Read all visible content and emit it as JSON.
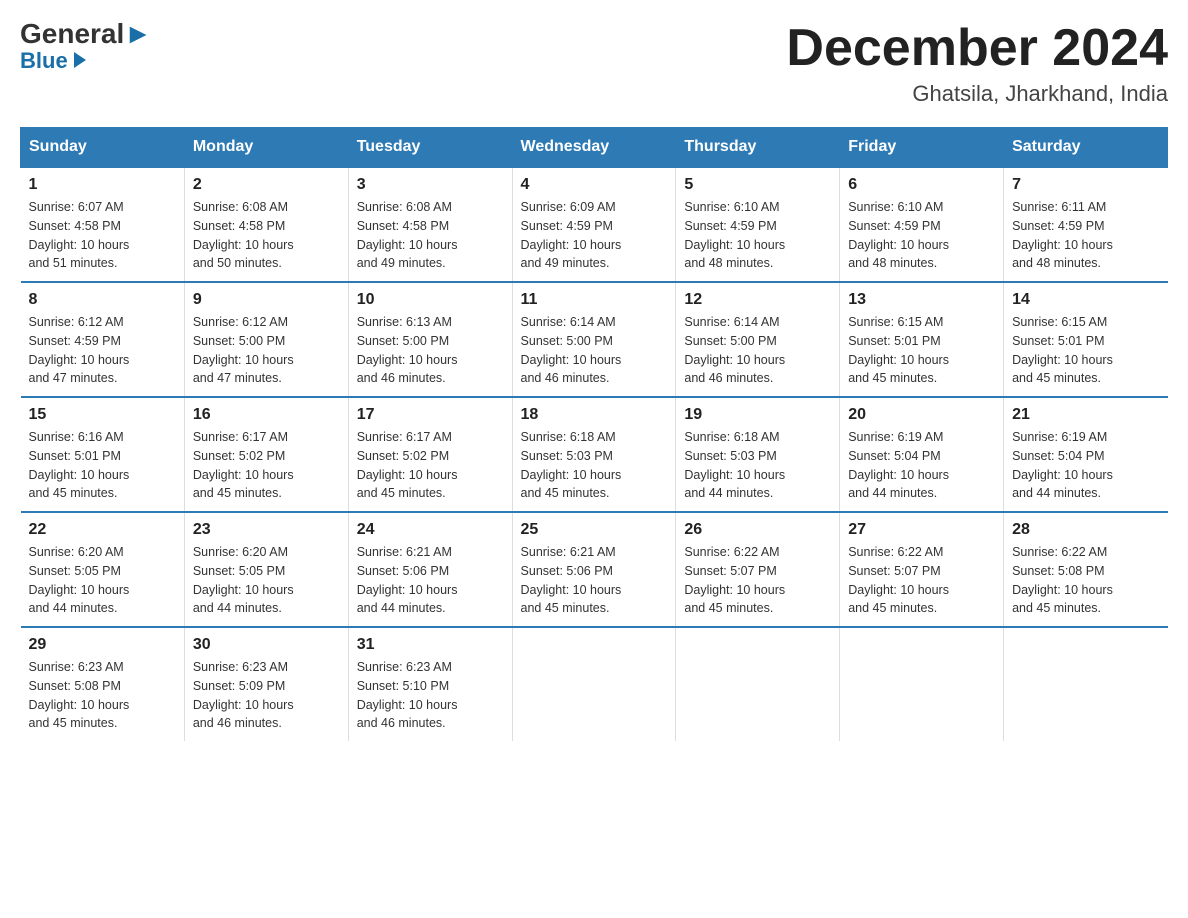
{
  "logo": {
    "general": "General",
    "blue": "Blue"
  },
  "title": "December 2024",
  "location": "Ghatsila, Jharkhand, India",
  "days_of_week": [
    "Sunday",
    "Monday",
    "Tuesday",
    "Wednesday",
    "Thursday",
    "Friday",
    "Saturday"
  ],
  "weeks": [
    [
      {
        "day": "1",
        "sunrise": "6:07 AM",
        "sunset": "4:58 PM",
        "daylight": "10 hours and 51 minutes."
      },
      {
        "day": "2",
        "sunrise": "6:08 AM",
        "sunset": "4:58 PM",
        "daylight": "10 hours and 50 minutes."
      },
      {
        "day": "3",
        "sunrise": "6:08 AM",
        "sunset": "4:58 PM",
        "daylight": "10 hours and 49 minutes."
      },
      {
        "day": "4",
        "sunrise": "6:09 AM",
        "sunset": "4:59 PM",
        "daylight": "10 hours and 49 minutes."
      },
      {
        "day": "5",
        "sunrise": "6:10 AM",
        "sunset": "4:59 PM",
        "daylight": "10 hours and 48 minutes."
      },
      {
        "day": "6",
        "sunrise": "6:10 AM",
        "sunset": "4:59 PM",
        "daylight": "10 hours and 48 minutes."
      },
      {
        "day": "7",
        "sunrise": "6:11 AM",
        "sunset": "4:59 PM",
        "daylight": "10 hours and 48 minutes."
      }
    ],
    [
      {
        "day": "8",
        "sunrise": "6:12 AM",
        "sunset": "4:59 PM",
        "daylight": "10 hours and 47 minutes."
      },
      {
        "day": "9",
        "sunrise": "6:12 AM",
        "sunset": "5:00 PM",
        "daylight": "10 hours and 47 minutes."
      },
      {
        "day": "10",
        "sunrise": "6:13 AM",
        "sunset": "5:00 PM",
        "daylight": "10 hours and 46 minutes."
      },
      {
        "day": "11",
        "sunrise": "6:14 AM",
        "sunset": "5:00 PM",
        "daylight": "10 hours and 46 minutes."
      },
      {
        "day": "12",
        "sunrise": "6:14 AM",
        "sunset": "5:00 PM",
        "daylight": "10 hours and 46 minutes."
      },
      {
        "day": "13",
        "sunrise": "6:15 AM",
        "sunset": "5:01 PM",
        "daylight": "10 hours and 45 minutes."
      },
      {
        "day": "14",
        "sunrise": "6:15 AM",
        "sunset": "5:01 PM",
        "daylight": "10 hours and 45 minutes."
      }
    ],
    [
      {
        "day": "15",
        "sunrise": "6:16 AM",
        "sunset": "5:01 PM",
        "daylight": "10 hours and 45 minutes."
      },
      {
        "day": "16",
        "sunrise": "6:17 AM",
        "sunset": "5:02 PM",
        "daylight": "10 hours and 45 minutes."
      },
      {
        "day": "17",
        "sunrise": "6:17 AM",
        "sunset": "5:02 PM",
        "daylight": "10 hours and 45 minutes."
      },
      {
        "day": "18",
        "sunrise": "6:18 AM",
        "sunset": "5:03 PM",
        "daylight": "10 hours and 45 minutes."
      },
      {
        "day": "19",
        "sunrise": "6:18 AM",
        "sunset": "5:03 PM",
        "daylight": "10 hours and 44 minutes."
      },
      {
        "day": "20",
        "sunrise": "6:19 AM",
        "sunset": "5:04 PM",
        "daylight": "10 hours and 44 minutes."
      },
      {
        "day": "21",
        "sunrise": "6:19 AM",
        "sunset": "5:04 PM",
        "daylight": "10 hours and 44 minutes."
      }
    ],
    [
      {
        "day": "22",
        "sunrise": "6:20 AM",
        "sunset": "5:05 PM",
        "daylight": "10 hours and 44 minutes."
      },
      {
        "day": "23",
        "sunrise": "6:20 AM",
        "sunset": "5:05 PM",
        "daylight": "10 hours and 44 minutes."
      },
      {
        "day": "24",
        "sunrise": "6:21 AM",
        "sunset": "5:06 PM",
        "daylight": "10 hours and 44 minutes."
      },
      {
        "day": "25",
        "sunrise": "6:21 AM",
        "sunset": "5:06 PM",
        "daylight": "10 hours and 45 minutes."
      },
      {
        "day": "26",
        "sunrise": "6:22 AM",
        "sunset": "5:07 PM",
        "daylight": "10 hours and 45 minutes."
      },
      {
        "day": "27",
        "sunrise": "6:22 AM",
        "sunset": "5:07 PM",
        "daylight": "10 hours and 45 minutes."
      },
      {
        "day": "28",
        "sunrise": "6:22 AM",
        "sunset": "5:08 PM",
        "daylight": "10 hours and 45 minutes."
      }
    ],
    [
      {
        "day": "29",
        "sunrise": "6:23 AM",
        "sunset": "5:08 PM",
        "daylight": "10 hours and 45 minutes."
      },
      {
        "day": "30",
        "sunrise": "6:23 AM",
        "sunset": "5:09 PM",
        "daylight": "10 hours and 46 minutes."
      },
      {
        "day": "31",
        "sunrise": "6:23 AM",
        "sunset": "5:10 PM",
        "daylight": "10 hours and 46 minutes."
      },
      null,
      null,
      null,
      null
    ]
  ],
  "labels": {
    "sunrise": "Sunrise:",
    "sunset": "Sunset:",
    "daylight": "Daylight:"
  }
}
